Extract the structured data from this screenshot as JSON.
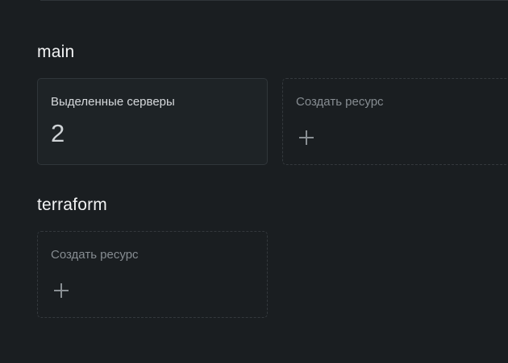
{
  "sections": [
    {
      "title": "main",
      "cards": [
        {
          "type": "resource",
          "title": "Выделенные серверы",
          "value": "2"
        },
        {
          "type": "create",
          "label": "Создать ресурс",
          "icon": "plus-icon"
        }
      ]
    },
    {
      "title": "terraform",
      "cards": [
        {
          "type": "create",
          "label": "Создать ресурс",
          "icon": "plus-icon"
        }
      ]
    }
  ],
  "colors": {
    "background": "#1a1e21",
    "card_background": "#1e2326",
    "card_border": "#30363a",
    "muted_text": "#868c91"
  }
}
